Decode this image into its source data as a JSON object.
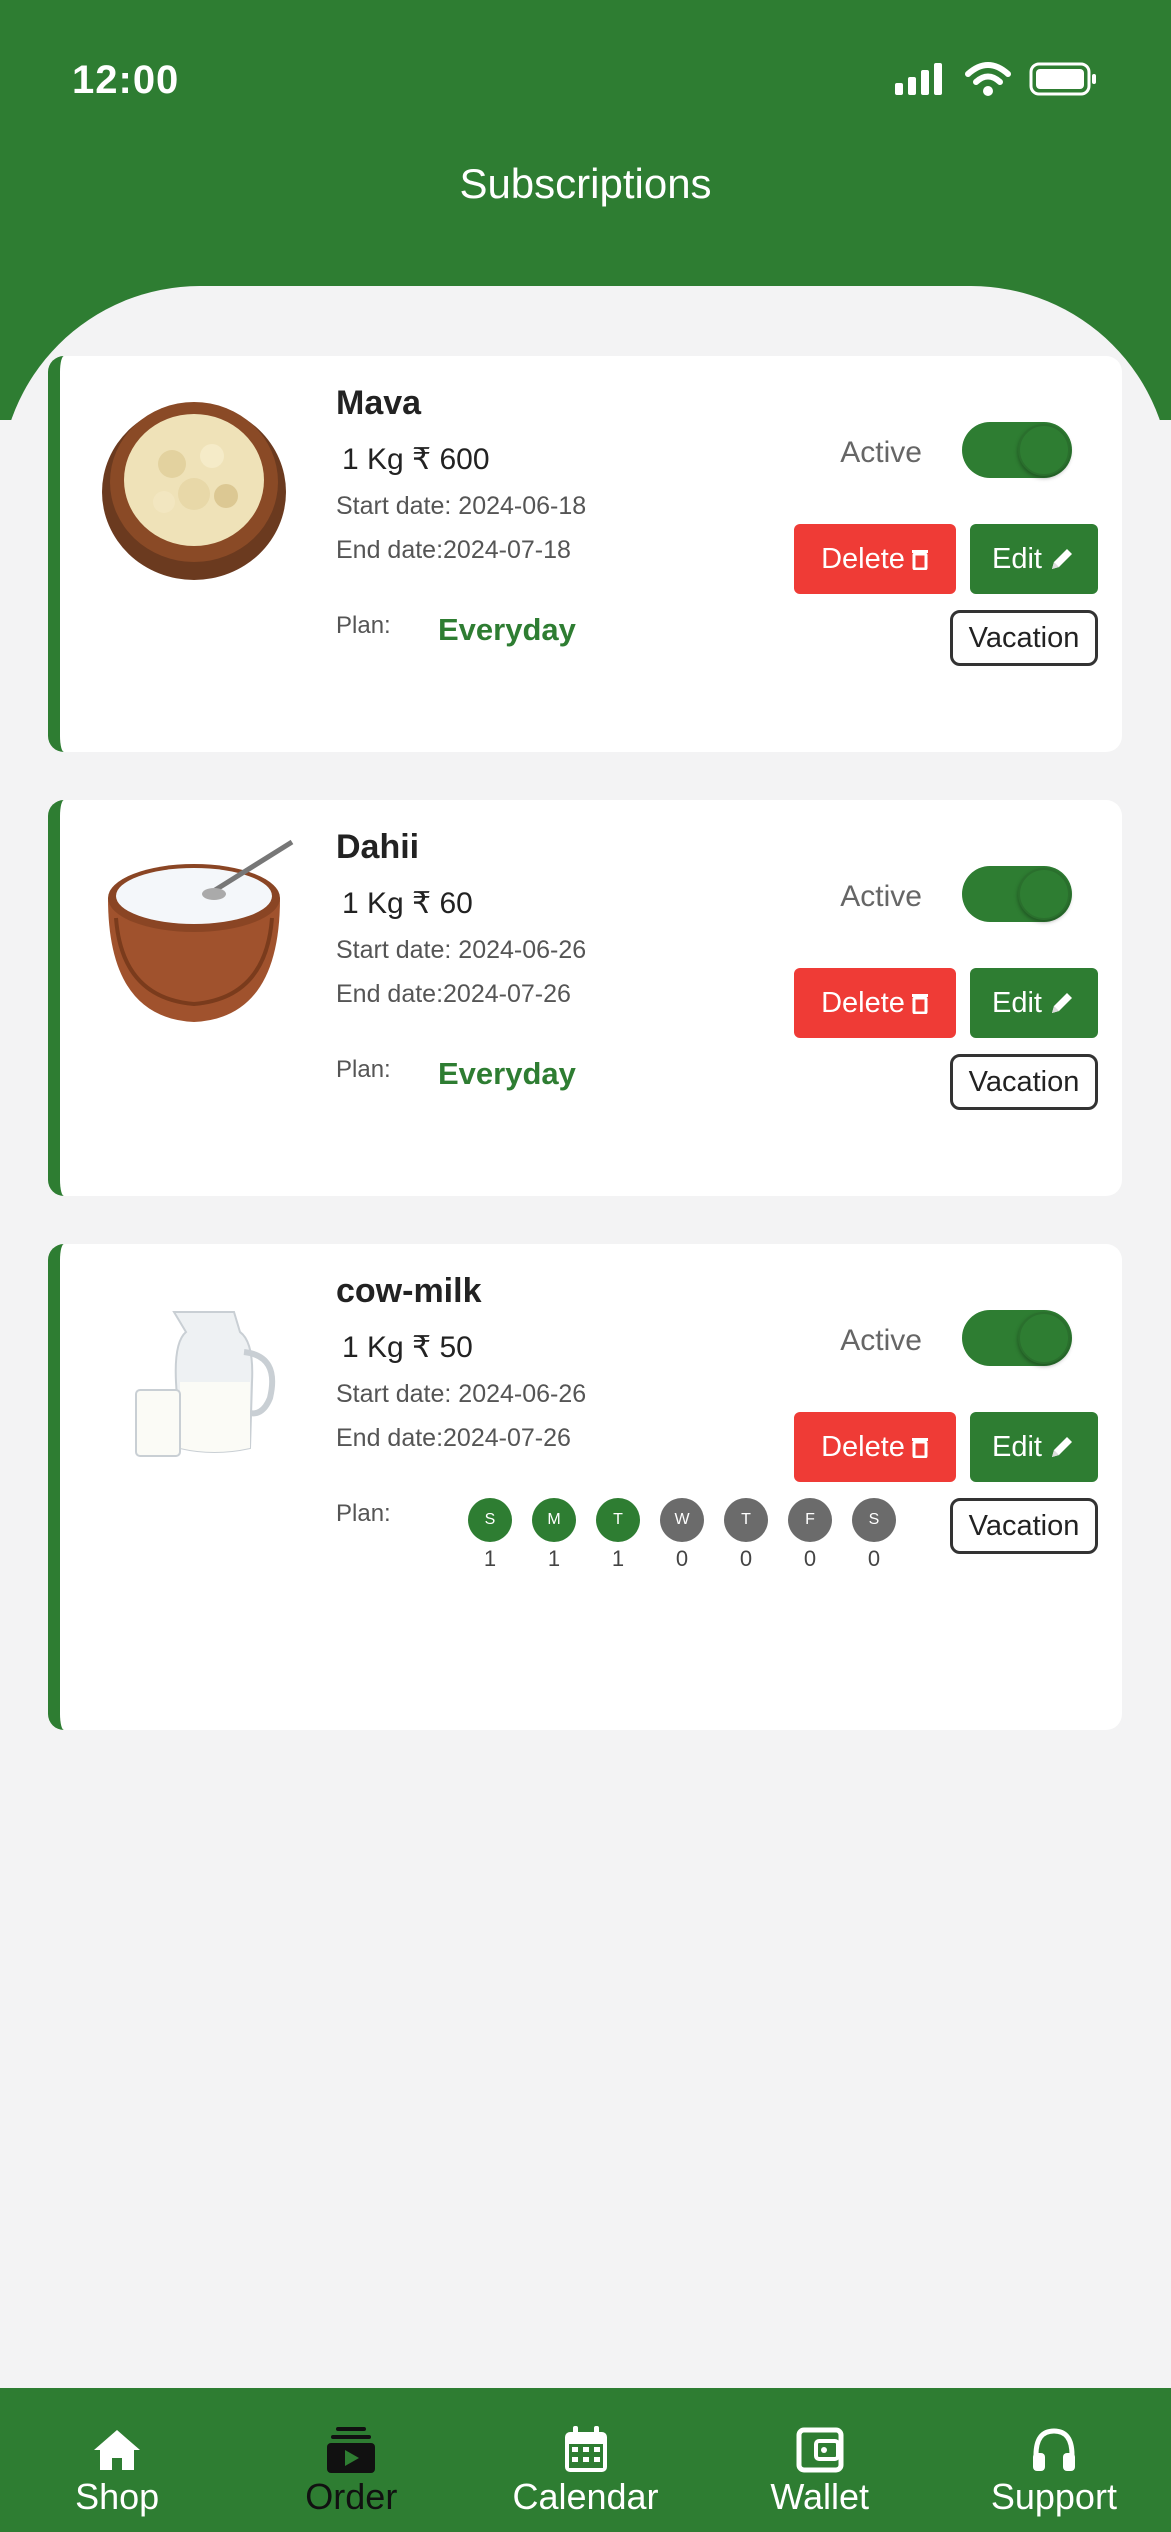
{
  "status": {
    "time": "12:00"
  },
  "header": {
    "title": "Subscriptions"
  },
  "subscriptions": [
    {
      "name": "Mava",
      "qty_price": "1 Kg ₹ 600",
      "start": "Start date: 2024-06-18",
      "end": "End date:2024-07-18",
      "plan_label": "Plan:",
      "plan": "Everyday",
      "status": "Active",
      "active": true,
      "delete_label": "Delete",
      "edit_label": "Edit",
      "vacation_label": "Vacation"
    },
    {
      "name": "Dahii",
      "qty_price": "1 Kg ₹ 60",
      "start": "Start date: 2024-06-26",
      "end": "End date:2024-07-26",
      "plan_label": "Plan:",
      "plan": "Everyday",
      "status": "Active",
      "active": true,
      "delete_label": "Delete",
      "edit_label": "Edit",
      "vacation_label": "Vacation"
    },
    {
      "name": "cow-milk",
      "qty_price": "1 Kg ₹ 50",
      "start": "Start date: 2024-06-26",
      "end": "End date:2024-07-26",
      "plan_label": "Plan:",
      "status": "Active",
      "active": true,
      "delete_label": "Delete",
      "edit_label": "Edit",
      "vacation_label": "Vacation",
      "days": [
        {
          "letter": "S",
          "count": "1"
        },
        {
          "letter": "M",
          "count": "1"
        },
        {
          "letter": "T",
          "count": "1"
        },
        {
          "letter": "W",
          "count": "0"
        },
        {
          "letter": "T",
          "count": "0"
        },
        {
          "letter": "F",
          "count": "0"
        },
        {
          "letter": "S",
          "count": "0"
        }
      ]
    }
  ],
  "nav": [
    {
      "label": "Shop",
      "icon": "home-icon"
    },
    {
      "label": "Order",
      "icon": "order-icon",
      "selected": true
    },
    {
      "label": "Calendar",
      "icon": "calendar-icon"
    },
    {
      "label": "Wallet",
      "icon": "wallet-icon"
    },
    {
      "label": "Support",
      "icon": "headphones-icon"
    }
  ],
  "colors": {
    "brand_green": "#2e7d32",
    "delete_red": "#ef3b36",
    "day_active": "#2e7d32",
    "day_inactive": "#6b6b6b",
    "background": "#f3f3f4"
  }
}
